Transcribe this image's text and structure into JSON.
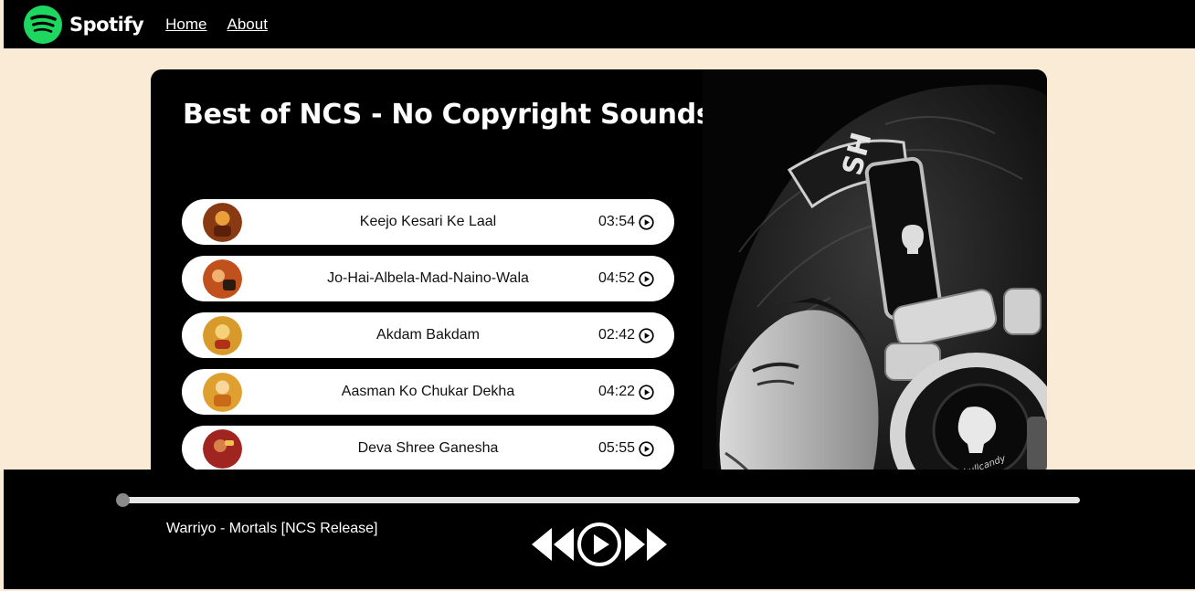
{
  "nav": {
    "brand": "Spotify",
    "links": [
      "Home",
      "About"
    ],
    "brand_color": "#1ED760"
  },
  "main": {
    "title": "Best of NCS - No Copyright Sounds",
    "songs": [
      {
        "name": "Keejo Kesari Ke Laal",
        "duration": "03:54",
        "cover_color": "#8a3a12"
      },
      {
        "name": "Jo-Hai-Albela-Mad-Naino-Wala",
        "duration": "04:52",
        "cover_color": "#c0501c"
      },
      {
        "name": "Akdam Bakdam",
        "duration": "02:42",
        "cover_color": "#d89a2a"
      },
      {
        "name": "Aasman Ko Chukar Dekha",
        "duration": "04:22",
        "cover_color": "#e0a030"
      },
      {
        "name": "Deva Shree Ganesha",
        "duration": "05:55",
        "cover_color": "#a02420"
      }
    ]
  },
  "player": {
    "now_playing": "Warriyo - Mortals [NCS Release]",
    "progress": 0
  },
  "icons": {
    "song_play": "play-circle-icon",
    "previous": "previous-icon",
    "play": "play-circle-icon",
    "next": "next-icon"
  }
}
